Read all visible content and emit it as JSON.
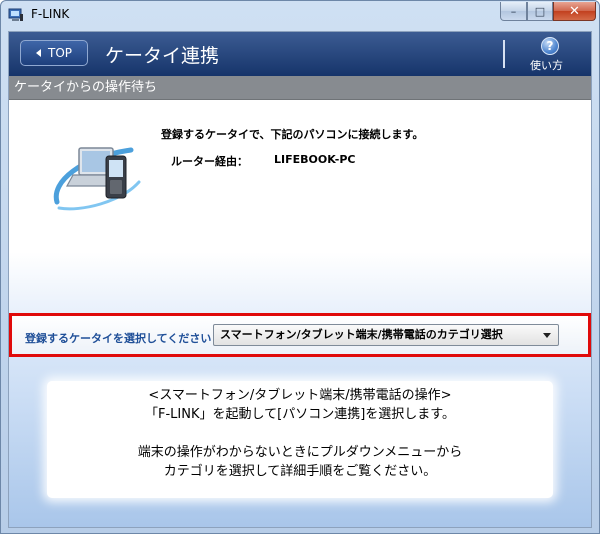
{
  "window": {
    "title": "F-LINK",
    "controls": {
      "minimize": "–",
      "maximize": "□",
      "close": "✕"
    }
  },
  "header": {
    "back_button": "TOP",
    "title": "ケータイ連携",
    "help_label": "使い方",
    "help_glyph": "?"
  },
  "section": {
    "title": "ケータイからの操作待ち"
  },
  "connection": {
    "message": "登録するケータイで、下記のパソコンに接続します。",
    "router_label": "ルーター経由：",
    "router_value": "LIFEBOOK-PC"
  },
  "selector": {
    "label": "登録するケータイを選択してください",
    "selected": "スマートフォン/タブレット端末/携帯電話のカテゴリ選択"
  },
  "info": {
    "line1": "<スマートフォン/タブレット端末/携帯電話の操作>",
    "line2": "「F-LINK」を起動して[パソコン連携]を選択します。",
    "line3": "端末の操作がわからないときにプルダウンメニューから",
    "line4": "カテゴリを選択して詳細手順をご覧ください。"
  },
  "colors": {
    "header": "#1e3f78",
    "section_bar": "#878b90",
    "highlight_border": "#e00a0a",
    "label_blue": "#1f4f98"
  },
  "icons": {
    "app": "app-window-icon",
    "back": "triangle-left-icon",
    "help": "help-question-icon",
    "device": "pc-phone-link-icon",
    "dropdown": "chevron-down-icon"
  }
}
